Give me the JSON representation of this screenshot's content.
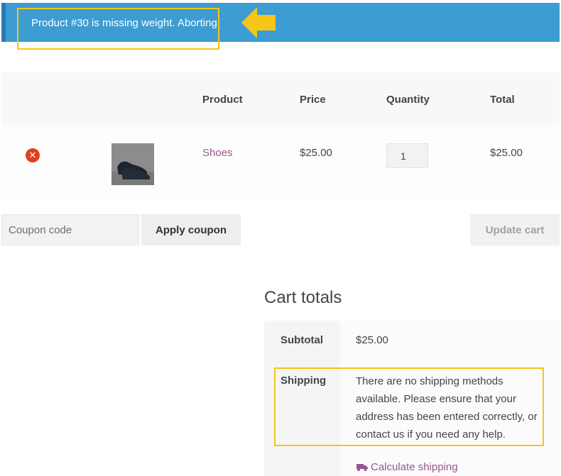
{
  "notice": {
    "message": "Product #30 is missing weight. Aborting."
  },
  "cart": {
    "headers": {
      "product": "Product",
      "price": "Price",
      "quantity": "Quantity",
      "total": "Total"
    },
    "items": [
      {
        "name": "Shoes",
        "price": "$25.00",
        "quantity": "1",
        "total": "$25.00",
        "remove_icon": "remove-circle-icon",
        "thumbnail": "shoe-thumbnail"
      }
    ]
  },
  "coupon": {
    "placeholder": "Coupon code",
    "apply_label": "Apply coupon"
  },
  "update_label": "Update cart",
  "totals": {
    "title": "Cart totals",
    "subtotal_label": "Subtotal",
    "subtotal_value": "$25.00",
    "shipping_label": "Shipping",
    "shipping_message": "There are no shipping methods available. Please ensure that your address has been entered correctly, or contact us if you need any help.",
    "calculate_label": "Calculate shipping",
    "calculate_icon": "truck-icon"
  },
  "colors": {
    "notice_bg": "#3d9cd2",
    "link": "#96588a",
    "highlight": "#f5c518",
    "remove": "#e2401c"
  }
}
